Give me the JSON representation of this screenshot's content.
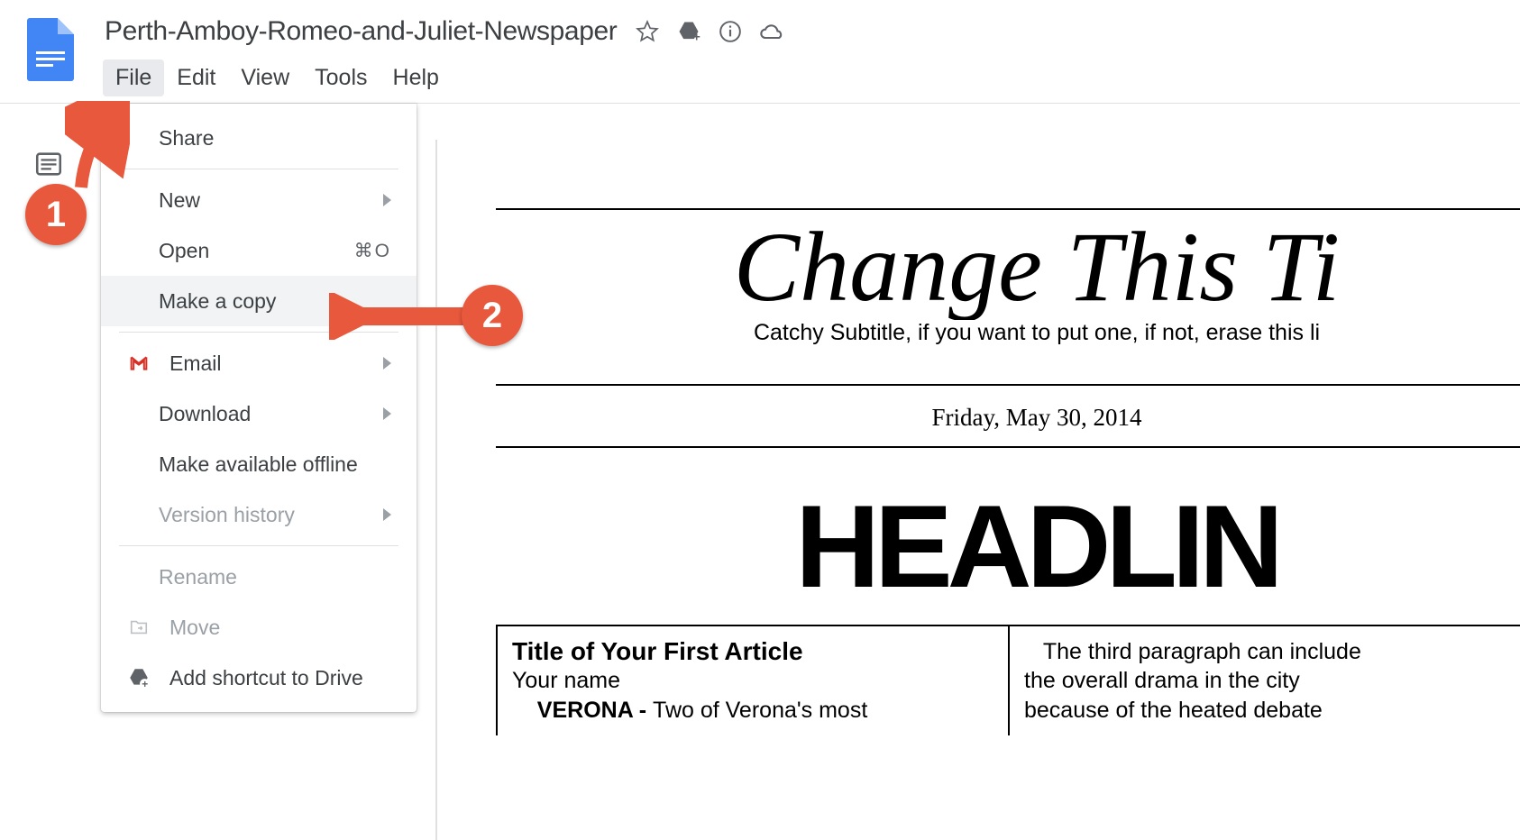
{
  "header": {
    "title": "Perth-Amboy-Romeo-and-Juliet-Newspaper",
    "menus": {
      "file": "File",
      "edit": "Edit",
      "view": "View",
      "tools": "Tools",
      "help": "Help"
    }
  },
  "dropdown": {
    "share": "Share",
    "new": "New",
    "open": "Open",
    "open_shortcut": "⌘O",
    "make_copy": "Make a copy",
    "email": "Email",
    "download": "Download",
    "offline": "Make available offline",
    "version_history": "Version history",
    "rename": "Rename",
    "move": "Move",
    "add_shortcut": "Add shortcut to Drive"
  },
  "doc": {
    "masthead_title": "Change This Ti",
    "masthead_sub": "Catchy Subtitle, if you want to put one, if not, erase this li",
    "date": "Friday, May 30, 2014",
    "headline": "HEADLIN",
    "article": {
      "title": "Title of Your First Article",
      "byline": "Your name",
      "dateline": "VERONA - ",
      "lede_rest": "Two of Verona's most"
    },
    "col2_line1": "The third paragraph can include",
    "col2_line2": "the overall drama in the city",
    "col2_line3": "because of the heated debate"
  },
  "annotations": {
    "one": "1",
    "two": "2"
  }
}
